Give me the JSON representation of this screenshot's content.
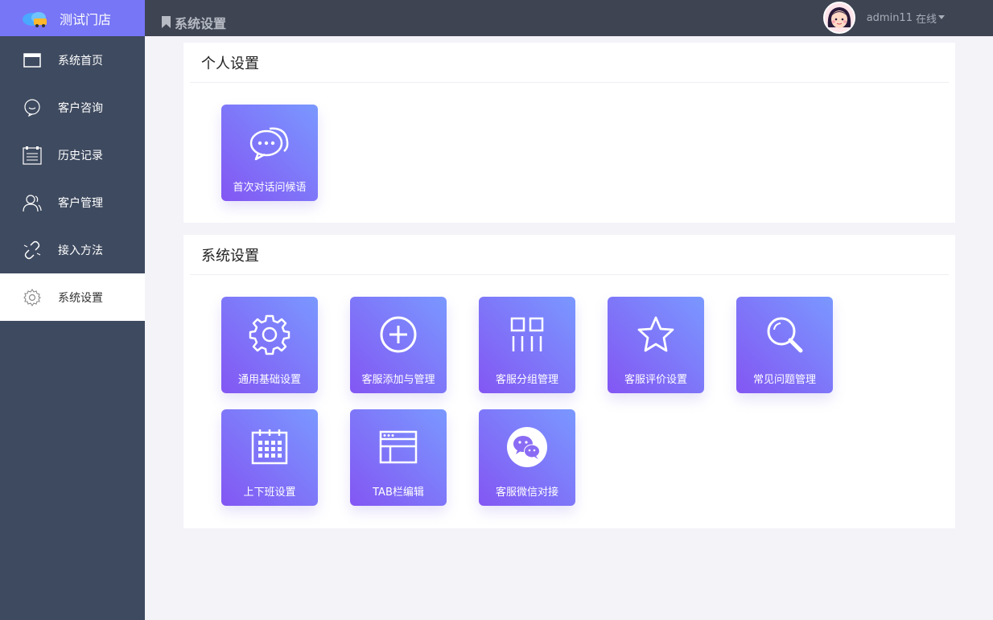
{
  "brand": {
    "name": "测试门店"
  },
  "sidebar": {
    "items": [
      {
        "label": "系统首页",
        "icon": "window-icon"
      },
      {
        "label": "客户咨询",
        "icon": "chat-bubble-icon"
      },
      {
        "label": "历史记录",
        "icon": "calendar-list-icon"
      },
      {
        "label": "客户管理",
        "icon": "users-icon"
      },
      {
        "label": "接入方法",
        "icon": "link-icon"
      },
      {
        "label": "系统设置",
        "icon": "gear-icon",
        "active": true
      }
    ]
  },
  "header": {
    "breadcrumb": "系统设置",
    "user": {
      "name": "admin11",
      "status": "在线"
    }
  },
  "personal": {
    "title": "个人设置",
    "tiles": [
      {
        "label": "首次对话问候语",
        "icon": "chat-dots-icon"
      }
    ]
  },
  "system": {
    "title": "系统设置",
    "tiles": [
      {
        "label": "通用基础设置",
        "icon": "gear-icon"
      },
      {
        "label": "客服添加与管理",
        "icon": "plus-circle-icon"
      },
      {
        "label": "客服分组管理",
        "icon": "group-grid-icon"
      },
      {
        "label": "客服评价设置",
        "icon": "star-icon"
      },
      {
        "label": "常见问题管理",
        "icon": "search-icon"
      },
      {
        "label": "上下班设置",
        "icon": "calendar-icon"
      },
      {
        "label": "TAB栏编辑",
        "icon": "browser-window-icon"
      },
      {
        "label": "客服微信对接",
        "icon": "wechat-icon"
      }
    ]
  },
  "colors": {
    "sidebar": "#3e4a5f",
    "brand": "#7776f6",
    "topbar": "#3e4452",
    "tile_start": "#8356f3",
    "tile_end": "#7a98ff"
  }
}
